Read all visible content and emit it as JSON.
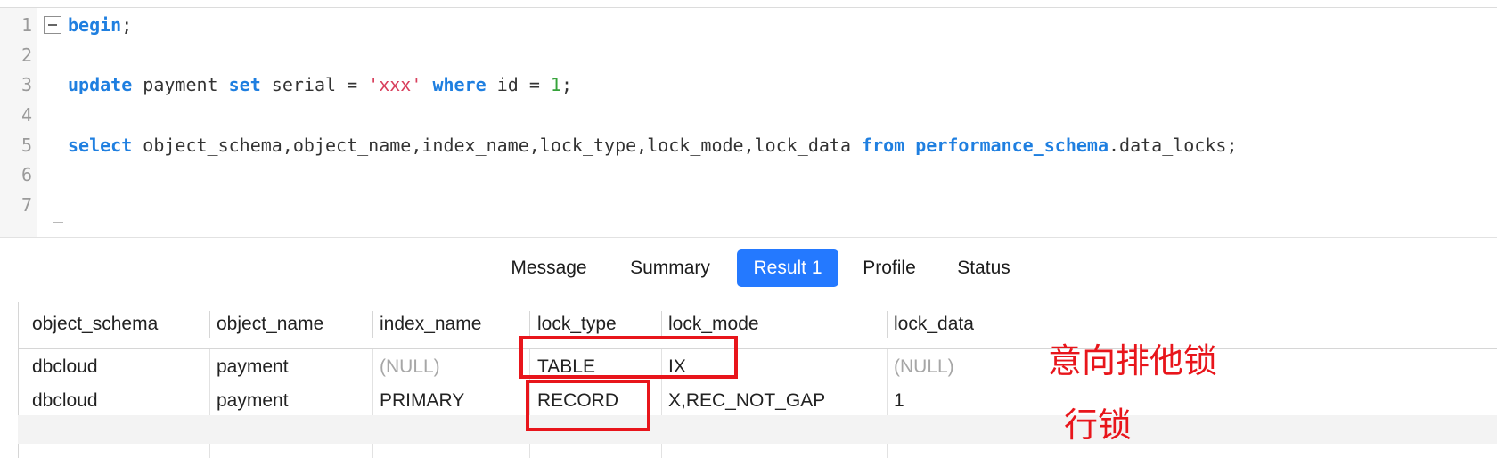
{
  "editor": {
    "line_numbers": [
      "1",
      "2",
      "3",
      "4",
      "5",
      "6",
      "7"
    ],
    "line1": {
      "kw": "begin",
      "rest": ";"
    },
    "line3": {
      "kw_update": "update",
      "t1": " payment ",
      "kw_set": "set",
      "t2": " serial = ",
      "str": "'xxx'",
      "t3": " ",
      "kw_where": "where",
      "t4": " id = ",
      "num": "1",
      "t5": ";"
    },
    "line5": {
      "kw_select": "select",
      "cols": " object_schema,object_name,index_name,lock_type,lock_mode,lock_data ",
      "kw_from": "from",
      "t1": " ",
      "schema": "performance_schema",
      "table": ".data_locks;"
    }
  },
  "tabs": [
    {
      "label": "Message",
      "active": false
    },
    {
      "label": "Summary",
      "active": false
    },
    {
      "label": "Result 1",
      "active": true
    },
    {
      "label": "Profile",
      "active": false
    },
    {
      "label": "Status",
      "active": false
    }
  ],
  "result": {
    "columns": [
      "object_schema",
      "object_name",
      "index_name",
      "lock_type",
      "lock_mode",
      "lock_data"
    ],
    "rows": [
      [
        "dbcloud",
        "payment",
        "(NULL)",
        "TABLE",
        "IX",
        "(NULL)"
      ],
      [
        "dbcloud",
        "payment",
        "PRIMARY",
        "RECORD",
        "X,REC_NOT_GAP",
        "1"
      ]
    ]
  },
  "annotations": {
    "intention_exclusive_lock": "意向排他锁",
    "row_lock": "行锁"
  },
  "colors": {
    "keyword": "#1f7fe0",
    "string": "#d83f5c",
    "number": "#36a33b",
    "active_tab": "#2479ff",
    "annotation_red": "#e8151b"
  }
}
